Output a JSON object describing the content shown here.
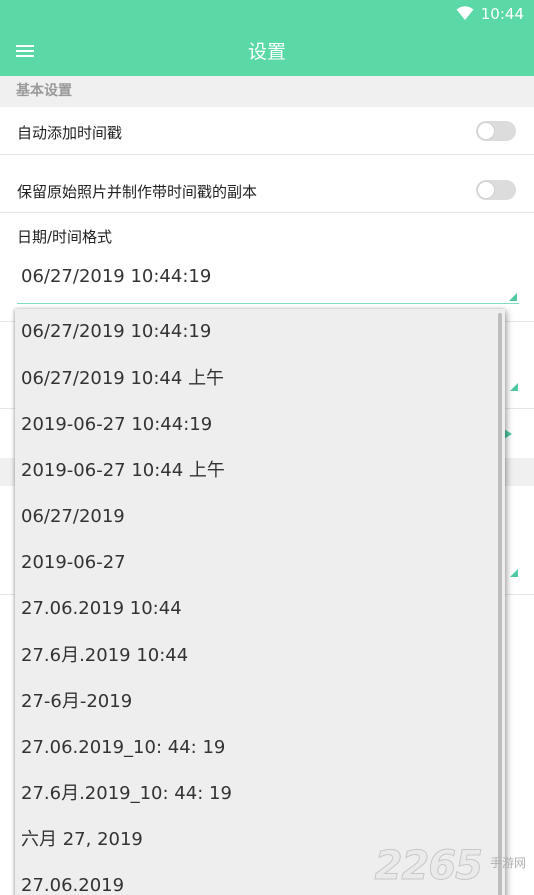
{
  "status_bar": {
    "time": "10:44",
    "wifi_icon": "wifi-icon"
  },
  "toolbar": {
    "title": "设置",
    "menu_icon": "menu-icon"
  },
  "sections": {
    "basic": "基本设置"
  },
  "settings": {
    "auto_timestamp": {
      "label": "自动添加时间戳",
      "enabled": false
    },
    "keep_original": {
      "label": "保留原始照片并制作带时间戳的副本",
      "enabled": false
    },
    "date_format": {
      "label": "日期/时间格式",
      "selected": "06/27/2019 10:44:19"
    }
  },
  "dropdown": {
    "options": [
      "06/27/2019 10:44:19",
      "06/27/2019 10:44 上午",
      "2019-06-27 10:44:19",
      "2019-06-27 10:44 上午",
      "06/27/2019",
      "2019-06-27",
      "27.06.2019 10:44",
      "27.6月.2019 10:44",
      "27-6月-2019",
      "27.06.2019_10: 44: 19",
      "27.6月.2019_10: 44: 19",
      "六月 27, 2019",
      "27.06.2019"
    ]
  },
  "watermark": {
    "number": "2265",
    "text": "手游网"
  },
  "colors": {
    "accent": "#5ad8a6",
    "toggle_off": "#dcdcdc",
    "dropdown_bg": "#eeeeee"
  }
}
